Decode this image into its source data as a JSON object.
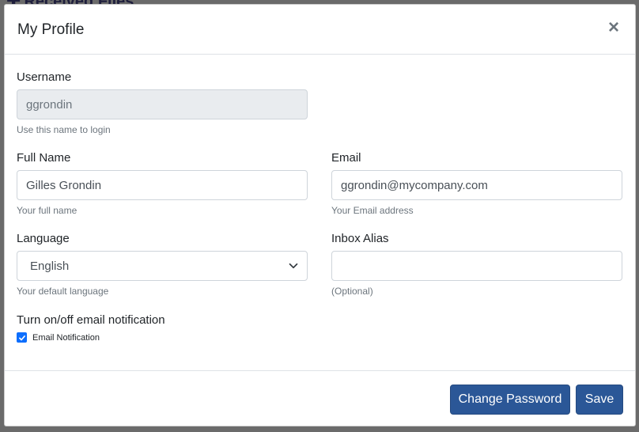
{
  "background": {
    "title": "Received Files"
  },
  "modal": {
    "title": "My Profile",
    "close_glyph": "×"
  },
  "fields": {
    "username": {
      "label": "Username",
      "value": "ggrondin",
      "help": "Use this name to login"
    },
    "full_name": {
      "label": "Full Name",
      "value": "Gilles Grondin",
      "help": "Your full name"
    },
    "email": {
      "label": "Email",
      "value": "ggrondin@mycompany.com",
      "help": "Your Email address"
    },
    "language": {
      "label": "Language",
      "selected": "English",
      "help": "Your default language"
    },
    "inbox_alias": {
      "label": "Inbox Alias",
      "value": "",
      "help": "(Optional)"
    }
  },
  "notification": {
    "title": "Turn on/off email notification",
    "checkbox_label": "Email Notification",
    "checked": true
  },
  "footer": {
    "change_password_label": "Change Password",
    "save_label": "Save"
  },
  "colors": {
    "primary_button": "#2b5797",
    "checkbox": "#0d6efd",
    "backdrop": "#6b6b6b"
  }
}
